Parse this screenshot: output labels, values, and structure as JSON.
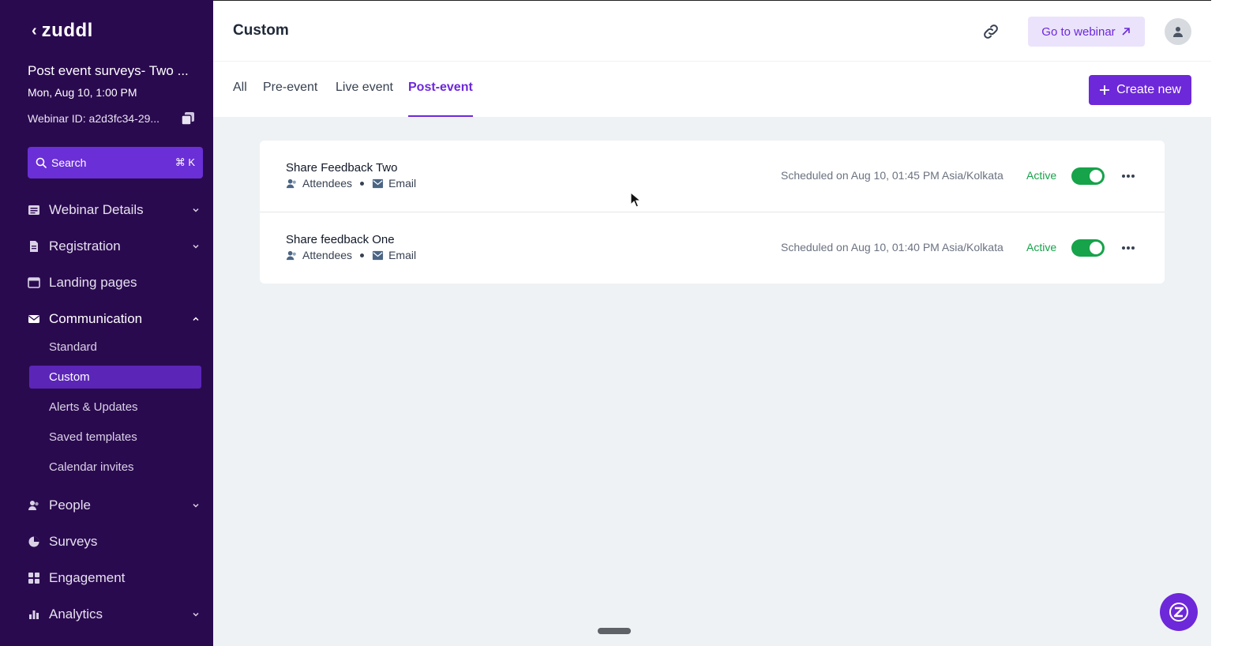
{
  "sidebar": {
    "brand": "zuddl",
    "event_title": "Post event surveys- Two ...",
    "event_date": "Mon, Aug 10, 1:00 PM",
    "webinar_id": "Webinar ID: a2d3fc34-29...",
    "search": {
      "label": "Search",
      "shortcut": "⌘ K"
    },
    "nav": [
      {
        "label": "Webinar Details",
        "icon": "document-icon"
      },
      {
        "label": "Registration",
        "icon": "file-icon"
      },
      {
        "label": "Landing pages",
        "icon": "browser-icon"
      },
      {
        "label": "Communication",
        "icon": "mail-icon"
      },
      {
        "label": "People",
        "icon": "people-icon"
      },
      {
        "label": "Surveys",
        "icon": "pie-chart-icon"
      },
      {
        "label": "Engagement",
        "icon": "grid-icon"
      },
      {
        "label": "Analytics",
        "icon": "bar-chart-icon"
      }
    ],
    "communication_sub": [
      "Standard",
      "Custom",
      "Alerts & Updates",
      "Saved templates",
      "Calendar invites"
    ]
  },
  "header": {
    "title": "Custom",
    "go_to_webinar": "Go to webinar"
  },
  "tabs": [
    "All",
    "Pre-event",
    "Live event",
    "Post-event"
  ],
  "active_tab": "Post-event",
  "create_new": "Create new",
  "items": [
    {
      "title": "Share Feedback Two",
      "audience": "Attendees",
      "channel": "Email",
      "schedule": "Scheduled on Aug 10, 01:45 PM Asia/Kolkata",
      "status": "Active"
    },
    {
      "title": "Share feedback One",
      "audience": "Attendees",
      "channel": "Email",
      "schedule": "Scheduled on Aug 10, 01:40 PM Asia/Kolkata",
      "status": "Active"
    }
  ],
  "colors": {
    "sidebar_bg": "#2a0a4f",
    "accent": "#6d28d9",
    "active_green": "#16a34a",
    "content_bg": "#eef2f5"
  }
}
